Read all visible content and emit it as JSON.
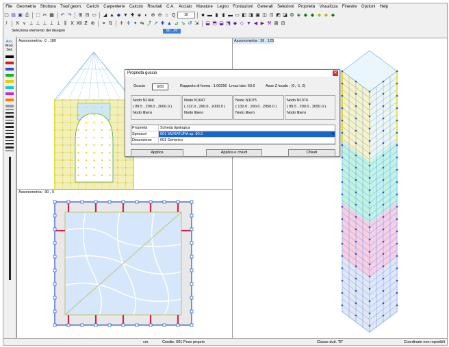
{
  "menu": [
    "File",
    "Geometria",
    "Struttura",
    "Trasf.geom.",
    "Carichi",
    "Carpenterie",
    "Calcolo",
    "Risultati",
    "C.A.",
    "Acciaio",
    "Murature",
    "Legno",
    "Fondazioni",
    "Generali",
    "Selezioni",
    "Proprietà",
    "Visualizza",
    "Finestre",
    "Opzioni",
    "Help"
  ],
  "toolbar": {
    "zoom_value": "10"
  },
  "status_top": {
    "hint": "Seleziona elemento del disegno",
    "coords": "90 , 30"
  },
  "palette": {
    "labels": [
      "Ass.",
      "Mod.",
      "Sel."
    ],
    "swatches": [
      "#000000",
      "#d22020",
      "#2a4fd0",
      "#19b419",
      "#e0d000",
      "#19c8c8",
      "#d020d0",
      "#f08000",
      "#9a9a9a"
    ]
  },
  "views": {
    "top_left": {
      "title": "Assonometria : 0 , 180"
    },
    "bottom_left": {
      "title": "Assonometria : 90 , 0"
    },
    "right": {
      "title": "Assonometria : 26 , 123"
    }
  },
  "dialog": {
    "title": "Proprietà guscio",
    "guscio_label": "Guscio",
    "guscio_value": "G55",
    "ratio": "Rapporto di forma : 1.00256",
    "lmax": "Lmax lato: 50.0",
    "axis": "Asse Z locale : (0, -1, 0)",
    "nodes": [
      {
        "name": "Nodo      N1046",
        "coord": "( 89.5 , 290.0 , 2000.0 )",
        "state": "Nodo libero"
      },
      {
        "name": "Nodo      N1047",
        "coord": "( 132.0 , 290.0 , 2000.0 )",
        "state": "Nodo libero"
      },
      {
        "name": "Nodo      N1075",
        "coord": "( 132.0 , 290.0 , 2050.0 )",
        "state": "Nodo libero"
      },
      {
        "name": "Nodo      N1074",
        "coord": "( 89.5 , 290.0 , 2050.0 )",
        "state": "Nodo libero"
      }
    ],
    "grid": [
      {
        "key": "Proprietà",
        "val": "Scheda tipologica"
      },
      {
        "key": "Spessori",
        "val": "001   MURATURA      sp. 80.0"
      },
      {
        "key": "Descrizione",
        "val": "001   Generico"
      }
    ],
    "buttons": {
      "apply": "Applica",
      "apply_close": "Applica e chiudi",
      "close": "Chiudi"
    }
  },
  "statusbar": {
    "units": "cm",
    "condition": "Condiz. 001   Peso proprio",
    "class": "Classe dutt. \"B\"",
    "coords": "Coordinate non reperibili"
  },
  "colors": {
    "selection": "#1c63c7",
    "panel": "#f3f0b5",
    "slab": "#d6e6fb"
  }
}
